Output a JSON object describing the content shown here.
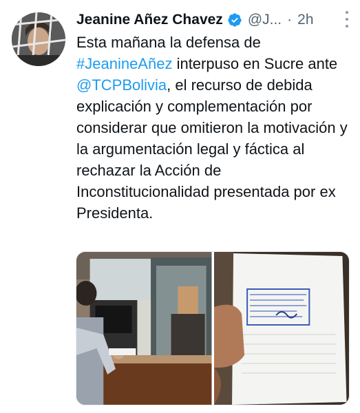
{
  "author": {
    "name": "Jeanine Añez Chavez",
    "handle": "@J...",
    "time": "2h",
    "separator": "·"
  },
  "icons": {
    "verified": "verified-badge-icon",
    "more": "more-vertical-icon"
  },
  "tweet": {
    "text_1": "Esta mañana la defensa de ",
    "hashtag": "#JeanineAñez",
    "text_2": " interpuso en Sucre ante ",
    "mention": "@TCPBolivia",
    "text_3": ", el recurso de debida explicación y complementación por considerar que omitieron la motivación y la argumentación legal y fáctica al rechazar la Acción de Inconstitucionalidad presentada por ex Presidenta."
  },
  "colors": {
    "link": "#1d9bf0",
    "secondary_text": "#536471",
    "verified": "#1d9bf0"
  }
}
